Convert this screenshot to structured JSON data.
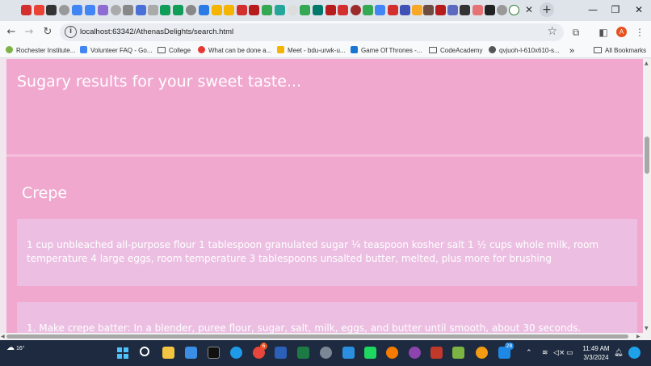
{
  "browser": {
    "tab_close_glyph": "✕",
    "new_tab_glyph": "+",
    "window_controls": {
      "minimize": "—",
      "restore": "❐",
      "close": "✕"
    },
    "nav": {
      "back": "←",
      "forward": "→",
      "reload": "↻"
    },
    "address_bar": {
      "info_glyph": "i",
      "url": "localhost:63342/AthenasDelights/search.html",
      "star_glyph": "☆"
    },
    "toolbar_icons": {
      "extensions": "⧉",
      "sidepanel": "◧",
      "avatar_letter": "A",
      "menu": "⋮"
    },
    "bookmarks": [
      {
        "label": "Rochester Institute...",
        "icon": "page-icon",
        "color": "#7cb342"
      },
      {
        "label": "Volunteer FAQ - Go...",
        "icon": "doc-icon",
        "color": "#4285f4"
      },
      {
        "label": "College",
        "icon": "folder-icon"
      },
      {
        "label": "What can be done a...",
        "icon": "chat-icon",
        "color": "#e53935"
      },
      {
        "label": "Meet - bdu-urwk-u...",
        "icon": "meet-icon",
        "color": "#f4b400"
      },
      {
        "label": "Game Of Thrones -...",
        "icon": "page-icon",
        "color": "#1976d2"
      },
      {
        "label": "CodeAcademy",
        "icon": "folder-icon"
      },
      {
        "label": "qvjuoh-l-610x610-s...",
        "icon": "globe-icon",
        "color": "#555555"
      }
    ],
    "bookmarks_overflow": "»",
    "all_bookmarks": "All Bookmarks"
  },
  "page": {
    "banner_title": "Sugary results for your sweet taste...",
    "recipe": {
      "title": "Crepe",
      "ingredients": "1 cup unbleached all-purpose flour 1 tablespoon granulated sugar ¼ teaspoon kosher salt 1 ½ cups whole milk, room temperature 4 large eggs, room temperature 3 tablespoons unsalted butter, melted, plus more for brushing",
      "instructions": "1. Make crepe batter: In a blender, puree flour, sugar, salt, milk, eggs, and butter until smooth, about 30 seconds."
    },
    "colors": {
      "background": "#f1e6ee",
      "panel": "#f0a8cf",
      "inner_box": "#ecbfe2",
      "text": "#ffffff"
    }
  },
  "taskbar": {
    "weather": "16°",
    "time": "11:49 AM",
    "date": "3/3/2024",
    "chrome_badge": "6",
    "notification_badge": "28"
  }
}
